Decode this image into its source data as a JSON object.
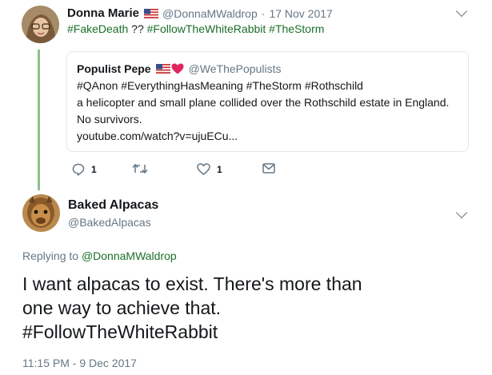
{
  "parent_tweet": {
    "name": "Donna Marie",
    "handle": "@DonnaMWaldrop",
    "separator": "·",
    "date": "17 Nov 2017",
    "body_parts": [
      {
        "text": "#FakeDeath",
        "type": "hashtag"
      },
      {
        "text": " ?? ",
        "type": "text"
      },
      {
        "text": "#FollowTheWhiteRabbit",
        "type": "hashtag"
      },
      {
        "text": " ",
        "type": "text"
      },
      {
        "text": "#TheStorm",
        "type": "hashtag"
      }
    ],
    "quoted": {
      "name": "Populist Pepe",
      "handle": "@WeThePopulists",
      "line1": "#QAnon #EverythingHasMeaning #TheStorm #Rothschild",
      "line2": "a helicopter and small plane collided over the Rothschild estate in England.",
      "line3": "No survivors.",
      "line4": "youtube.com/watch?v=ujuECu..."
    },
    "actions": {
      "reply_count": "1",
      "retweet_count": "",
      "like_count": "1"
    }
  },
  "main_tweet": {
    "name": "Baked Alpacas",
    "handle": "@BakedAlpacas",
    "replying_prefix": "Replying to",
    "replying_handle": "@DonnaMWaldrop",
    "line1": "I want alpacas to exist. There's more than",
    "line2": "one way to achieve that.",
    "hashtag": "#FollowTheWhiteRabbit",
    "timestamp": "11:15 PM - 9 Dec 2017"
  },
  "icons": {
    "reply": "reply-icon",
    "retweet": "retweet-icon",
    "like": "heart-icon",
    "dm": "envelope-icon",
    "more": "chevron-down-icon"
  },
  "colors": {
    "hashtag": "#1b6e2a",
    "thread_line": "#8fbf8a",
    "muted": "#657786",
    "heart": "#e0245e"
  }
}
